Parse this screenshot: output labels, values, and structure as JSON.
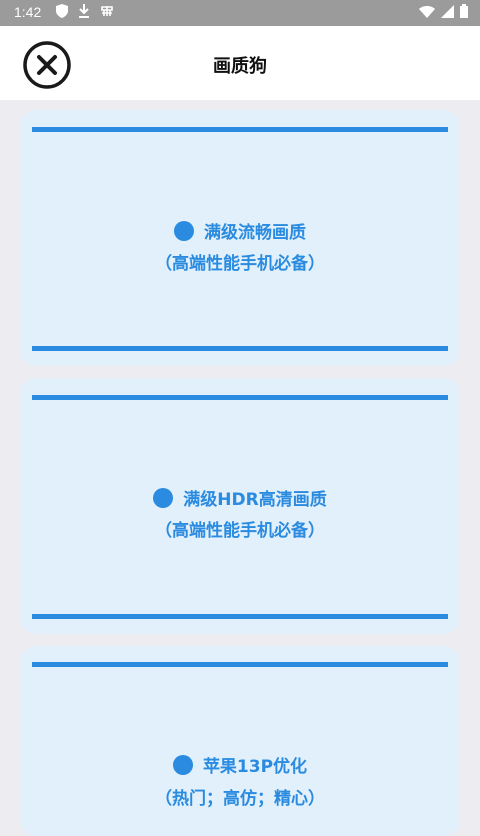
{
  "status_bar": {
    "time": "1:42",
    "left_icons": [
      "shield-icon",
      "download-icon",
      "debug-icon"
    ],
    "right_icons": [
      "wifi-icon",
      "signal-icon",
      "battery-icon"
    ]
  },
  "header": {
    "title": "画质狗",
    "close_icon": "close-circle-icon"
  },
  "accent_color": "#2a8be0",
  "card_background": "#e1f0fb",
  "options": [
    {
      "title": "满级流畅画质",
      "subtitle": "（高端性能手机必备）"
    },
    {
      "title": "满级HDR高清画质",
      "subtitle": "（高端性能手机必备）"
    },
    {
      "title": "苹果13P优化",
      "subtitle": "（热门；高仿；精心）"
    }
  ]
}
